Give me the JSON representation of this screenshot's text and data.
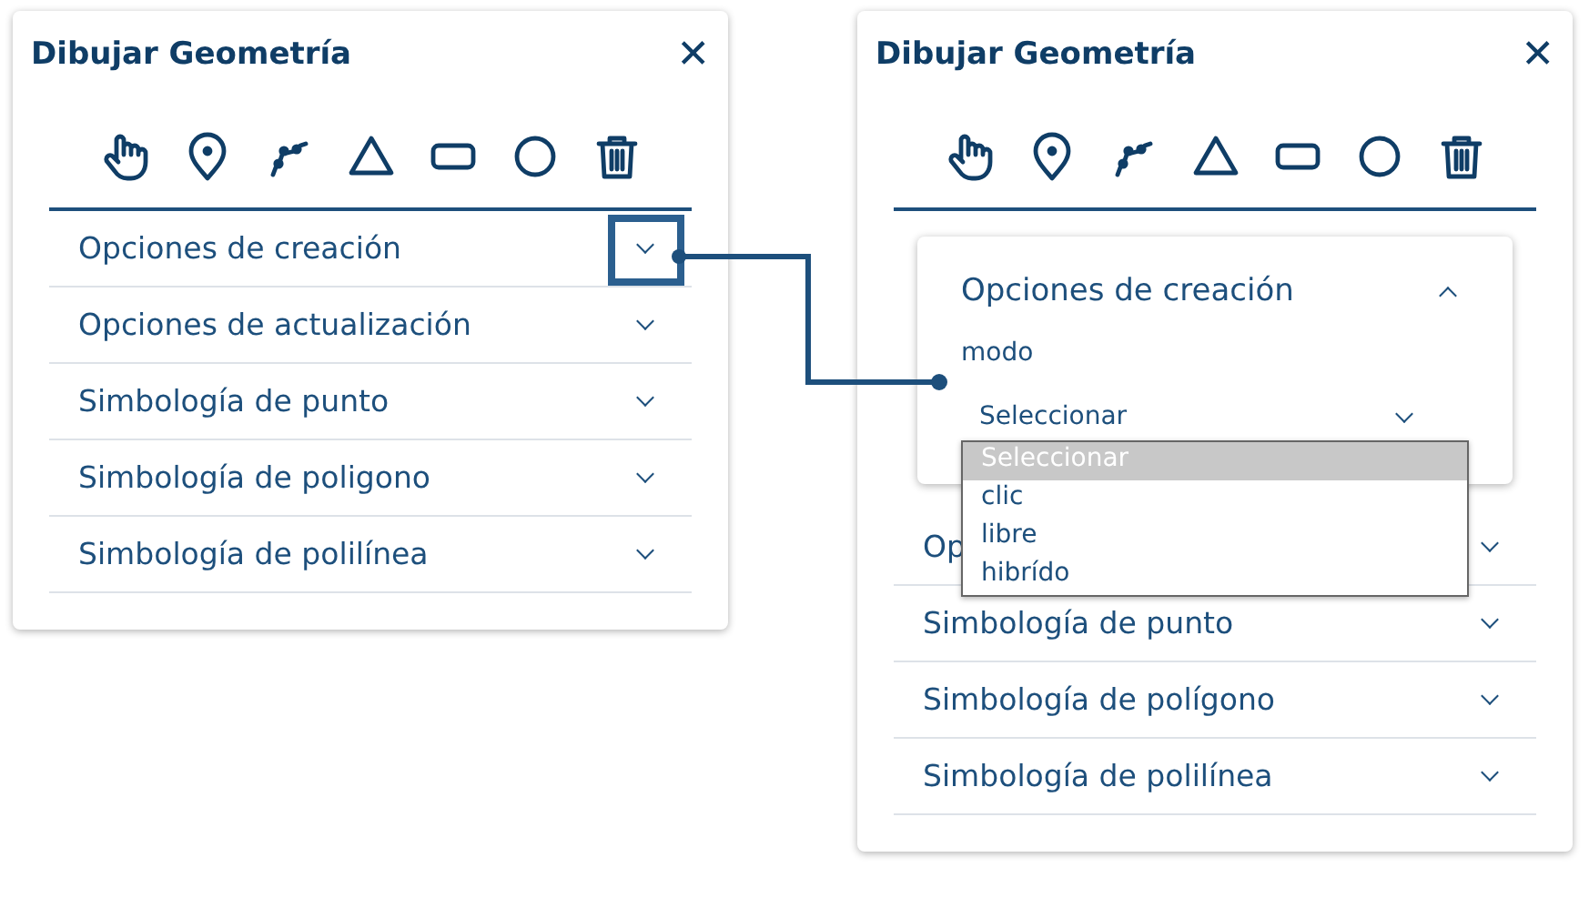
{
  "panels": [
    {
      "title": "Dibujar Geometría",
      "close": "✕",
      "sections": [
        {
          "label": "Opciones de creación",
          "expanded": false,
          "highlighted": true
        },
        {
          "label": "Opciones de actualización",
          "expanded": false,
          "highlighted": false
        },
        {
          "label": "Simbología de punto",
          "expanded": false,
          "highlighted": false
        },
        {
          "label": "Simbología de poligono",
          "expanded": false,
          "highlighted": false
        },
        {
          "label": "Simbología de polilínea",
          "expanded": false,
          "highlighted": false
        }
      ]
    },
    {
      "title": "Dibujar Geometría",
      "close": "✕",
      "sections": [
        {
          "label": "Opciones de creación",
          "expanded": true,
          "highlighted": false,
          "field": {
            "label": "modo",
            "value": "Seleccionar",
            "open": true,
            "options": [
              {
                "label": "Seleccionar",
                "selected": true
              },
              {
                "label": "clic",
                "selected": false
              },
              {
                "label": "libre",
                "selected": false
              },
              {
                "label": "hibrído",
                "selected": false
              }
            ]
          }
        },
        {
          "label": "Op",
          "expanded": false,
          "highlighted": false
        },
        {
          "label": "Simbología de punto",
          "expanded": false,
          "highlighted": false
        },
        {
          "label": "Simbología de polígono",
          "expanded": false,
          "highlighted": false
        },
        {
          "label": "Simbología de polilínea",
          "expanded": false,
          "highlighted": false
        }
      ]
    }
  ]
}
